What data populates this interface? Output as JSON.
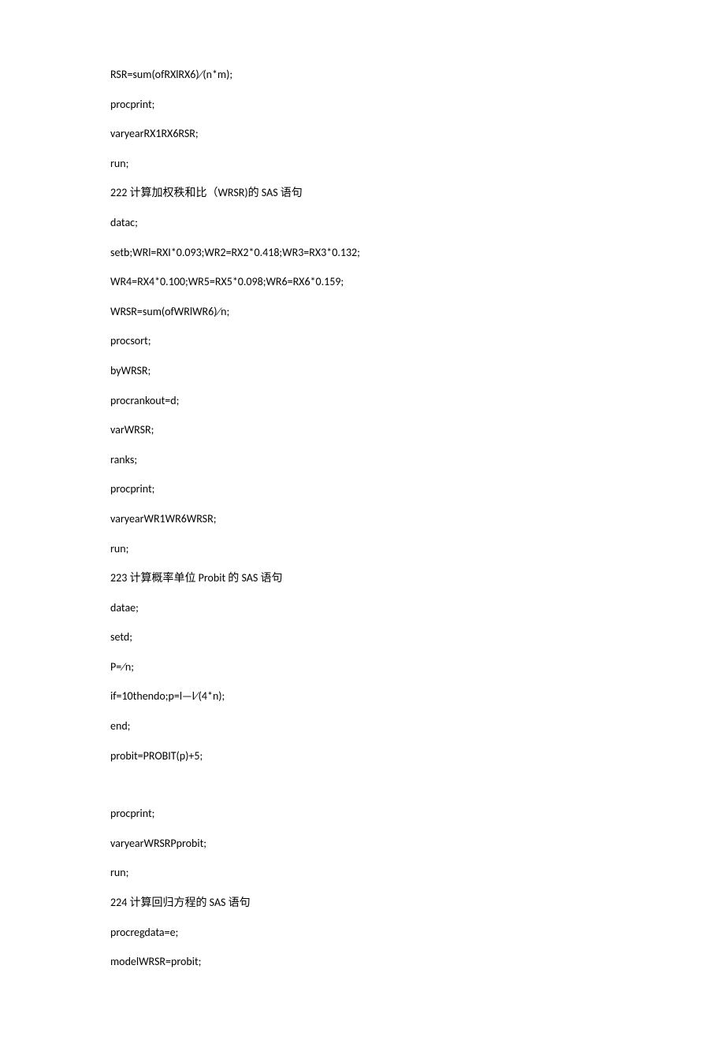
{
  "lines": [
    "RSR=sum(ofRXlRX6)∕(n*m);",
    "procprint;",
    "varyearRX1RX6RSR;",
    "run;",
    "222 计算加权秩和比（WRSR)的 SAS 语句",
    "datac;",
    "setb;WRl=RXI*0.093;WR2=RX2*0.418;WR3=RX3*0.132;",
    "WR4=RX4*0.100;WR5=RX5*0.098;WR6=RX6*0.159;",
    "WRSR=sum(ofWRlWR6)∕n;",
    "procsort;",
    "byWRSR;",
    "procrankout=d;",
    "varWRSR;",
    "ranks;",
    "procprint;",
    "varyearWR1WR6WRSR;",
    "run;",
    "223 计算概率单位 Probit 的 SAS 语句",
    "datae;",
    "setd;",
    "P=∕n;",
    "if=10thendo;p=l—l∕(4*n);",
    "end;",
    "probit=PROBIT(p)+5;",
    "",
    "procprint;",
    "varyearWRSRPprobit;",
    "run;",
    "224 计算回归方程的 SAS 语句",
    "procregdata=e;",
    "modelWRSR=probit;"
  ]
}
